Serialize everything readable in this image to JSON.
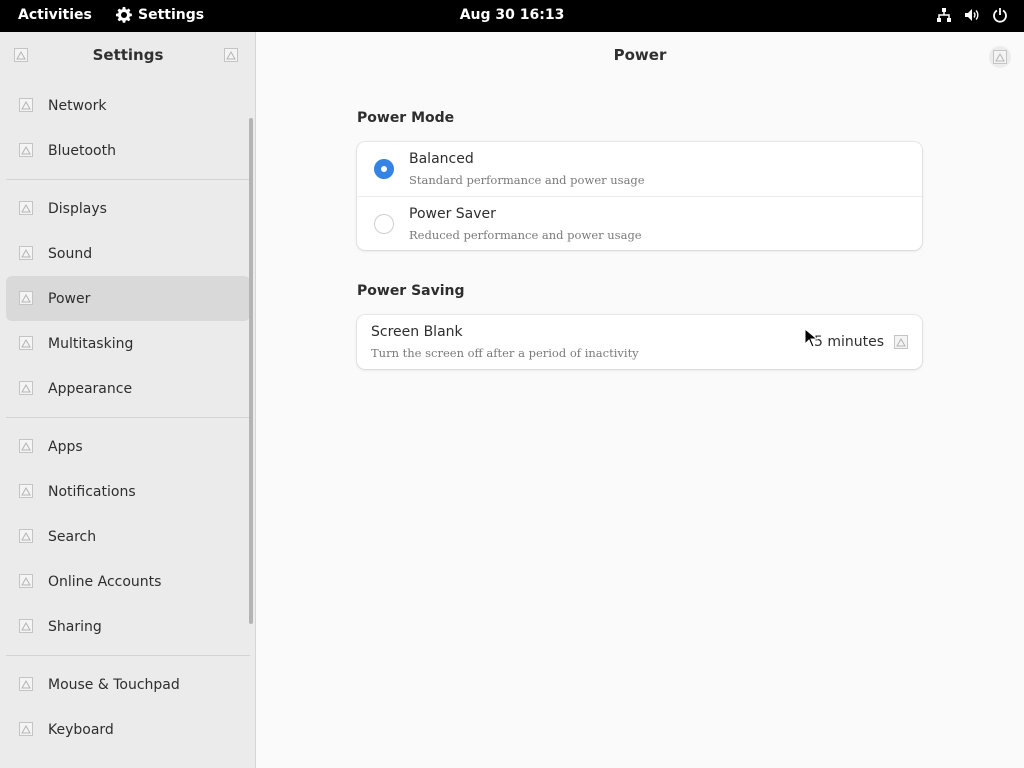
{
  "topbar": {
    "activities": "Activities",
    "app_name": "Settings",
    "clock": "Aug 30  16:13"
  },
  "sidebar": {
    "title": "Settings",
    "groups": [
      [
        {
          "label": "Network"
        },
        {
          "label": "Bluetooth"
        }
      ],
      [
        {
          "label": "Displays"
        },
        {
          "label": "Sound"
        },
        {
          "label": "Power"
        },
        {
          "label": "Multitasking"
        },
        {
          "label": "Appearance"
        }
      ],
      [
        {
          "label": "Apps"
        },
        {
          "label": "Notifications"
        },
        {
          "label": "Search"
        },
        {
          "label": "Online Accounts"
        },
        {
          "label": "Sharing"
        }
      ],
      [
        {
          "label": "Mouse & Touchpad"
        },
        {
          "label": "Keyboard"
        }
      ]
    ],
    "active_item": "Power"
  },
  "main": {
    "title": "Power",
    "power_mode": {
      "heading": "Power Mode",
      "options": [
        {
          "title": "Balanced",
          "subtitle": "Standard performance and power usage",
          "selected": true
        },
        {
          "title": "Power Saver",
          "subtitle": "Reduced performance and power usage",
          "selected": false
        }
      ]
    },
    "power_saving": {
      "heading": "Power Saving",
      "screen_blank": {
        "title": "Screen Blank",
        "subtitle": "Turn the screen off after a period of inactivity",
        "value": "5 minutes"
      }
    }
  },
  "colors": {
    "accent": "#3584e4",
    "topbar": "#000000",
    "sidebar_bg": "#ebebeb",
    "active_row": "#d9d9d9"
  },
  "icons": {
    "missing": "broken-image-icon",
    "network": "network-icon",
    "volume": "volume-icon",
    "power": "power-icon",
    "gear": "gear-icon"
  }
}
